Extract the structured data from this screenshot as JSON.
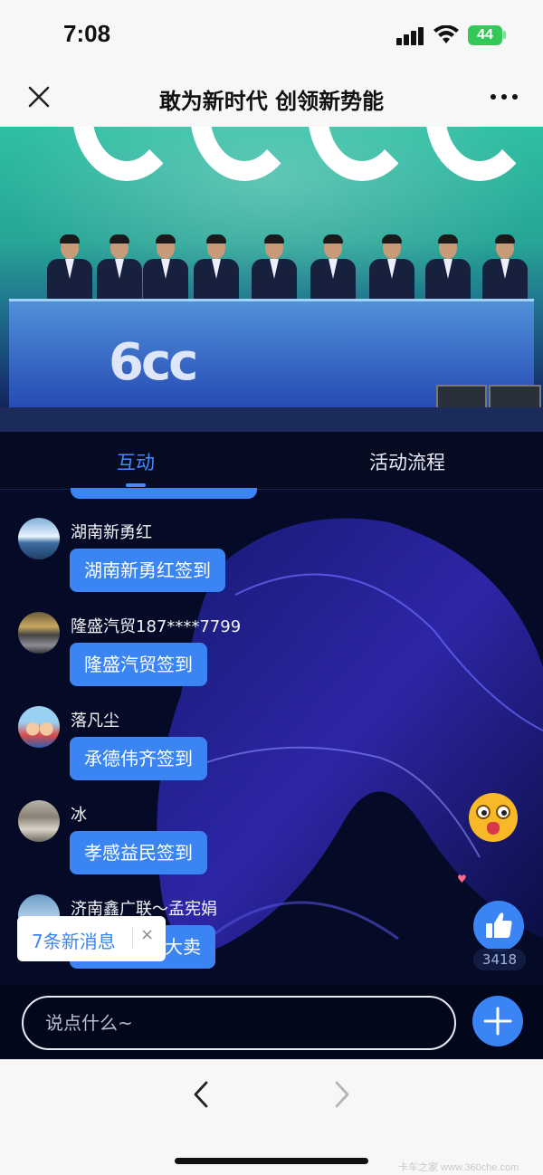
{
  "status_bar": {
    "time": "7:08",
    "battery": "44"
  },
  "nav": {
    "title": "敢为新时代 创领新势能",
    "close_icon": "close-icon",
    "more_icon": "more-icon"
  },
  "tabs": [
    {
      "label": "互动",
      "active": true
    },
    {
      "label": "活动流程",
      "active": false
    }
  ],
  "messages": [
    {
      "name": "湖南新勇红",
      "text": "湖南新勇红签到"
    },
    {
      "name": "隆盛汽贸187****7799",
      "text": "隆盛汽贸签到"
    },
    {
      "name": "落凡尘",
      "text": "承德伟齐签到"
    },
    {
      "name": "冰",
      "text": "孝感益民签到"
    },
    {
      "name": "济南鑫广联～孟宪娟",
      "text": "大卖"
    }
  ],
  "new_messages": {
    "label": "7条新消息",
    "close": "×"
  },
  "likes": {
    "count": "3418"
  },
  "input": {
    "placeholder": "说点什么~"
  },
  "colors": {
    "accent": "#3a84f4",
    "background": "#050a26"
  }
}
